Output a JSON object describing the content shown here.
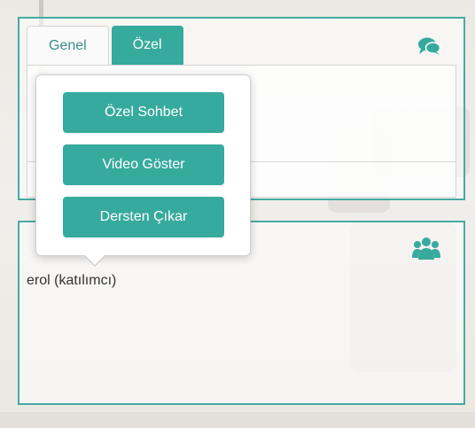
{
  "tabs": [
    {
      "label": "Genel",
      "active": false
    },
    {
      "label": "Özel",
      "active": true
    }
  ],
  "icons": {
    "chat": "chat-bubbles-icon",
    "participants": "users-group-icon"
  },
  "popover": {
    "buttons": [
      {
        "label": "Özel Sohbet"
      },
      {
        "label": "Video Göster"
      },
      {
        "label": "Dersten Çıkar"
      }
    ]
  },
  "participants": [
    {
      "name": "erol (katılımcı)"
    }
  ],
  "colors": {
    "accent": "#37aa9e",
    "panel_border": "#46aaa3",
    "tab_inactive_text": "#3c8f8a"
  }
}
